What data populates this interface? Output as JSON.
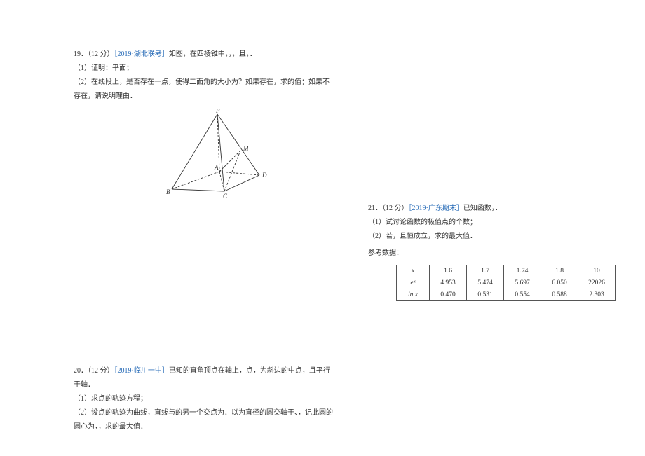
{
  "q19": {
    "prefix": "19．（12 分）",
    "link": "［2019·湖北联考］",
    "title_rest": "如图，在四棱锥中，，，且，．",
    "p1": "（1）证明：平面；",
    "p2": "（2）在线段上，是否存在一点，使得二面角的大小为？如果存在，求的值；如果不存在，请说明理由．",
    "labels": {
      "P": "P",
      "A": "A",
      "B": "B",
      "C": "C",
      "D": "D",
      "M": "M"
    }
  },
  "q20": {
    "prefix": "20．（12 分）",
    "link": "［2019·临川一中］",
    "title_rest": "已知的直角顶点在轴上，点，为斜边的中点，且平行于轴．",
    "p1": "（1）求点的轨迹方程；",
    "p2": "（2）设点的轨迹为曲线，直线与的另一个交点为．以为直径的圆交轴于、，记此圆的圆心为，，求的最大值．"
  },
  "q21": {
    "prefix": "21．（12 分）",
    "link": "［2019·广东期末］",
    "title_rest": "已知函数，．",
    "p1": "（1）试讨论函数的极值点的个数；",
    "p2": "（2）若，且恒成立，求的最大值．",
    "ref_label": "参考数据：",
    "table": {
      "header": [
        "x",
        "1.6",
        "1.7",
        "1.74",
        "1.8",
        "10"
      ],
      "row_ex": [
        "eˣ",
        "4.953",
        "5.474",
        "5.697",
        "6.050",
        "22026"
      ],
      "row_ln": [
        "ln x",
        "0.470",
        "0.531",
        "0.554",
        "0.588",
        "2.303"
      ]
    }
  },
  "chart_data": {
    "type": "table",
    "title": "参考数据",
    "columns": [
      "x",
      "eˣ",
      "ln x"
    ],
    "rows": [
      {
        "x": 1.6,
        "e^x": 4.953,
        "ln x": 0.47
      },
      {
        "x": 1.7,
        "e^x": 5.474,
        "ln x": 0.531
      },
      {
        "x": 1.74,
        "e^x": 5.697,
        "ln x": 0.554
      },
      {
        "x": 1.8,
        "e^x": 6.05,
        "ln x": 0.588
      },
      {
        "x": 10,
        "e^x": 22026,
        "ln x": 2.303
      }
    ]
  }
}
